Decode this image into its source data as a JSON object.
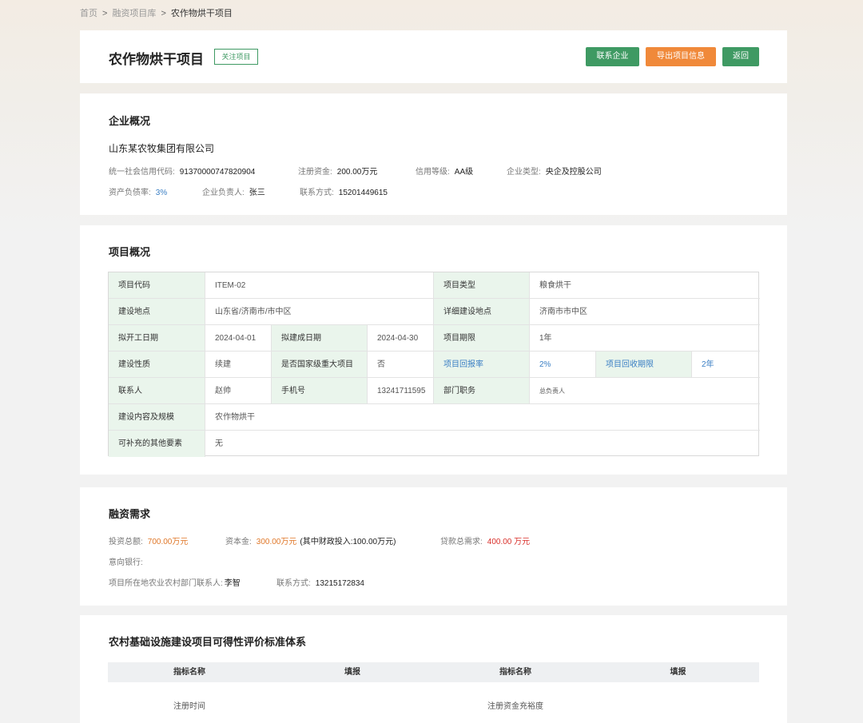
{
  "breadcrumb": [
    "首页",
    "融资项目库",
    "农作物烘干项目"
  ],
  "breadcrumb_sep": ">",
  "project": {
    "title": "农作物烘干项目",
    "follow_label": "关注项目",
    "actions": {
      "contact": "联系企业",
      "export": "导出项目信息",
      "back": "返回"
    }
  },
  "company": {
    "section_title": "企业概况",
    "name": "山东某农牧集团有限公司",
    "fields": [
      {
        "label": "统一社会信用代码:",
        "value": "91370000747820904"
      },
      {
        "label": "注册资金:",
        "value": "200.00万元"
      },
      {
        "label": "信用等级:",
        "value": "AA级"
      },
      {
        "label": "企业类型:",
        "value": "央企及控股公司"
      },
      {
        "label": "资产负债率:",
        "value": "3%"
      },
      {
        "label": "企业负责人:",
        "value": "张三"
      },
      {
        "label": "联系方式:",
        "value": "15201449615"
      }
    ]
  },
  "overview": {
    "section_title": "项目概况",
    "rows": [
      [
        "项目代码",
        "ITEM-02",
        "项目类型",
        "粮食烘干"
      ],
      [
        "建设地点",
        "山东省/济南市/市中区",
        "详细建设地点",
        "济南市市中区"
      ],
      [
        "拟开工日期",
        "2024-04-01",
        "拟建成日期",
        "2024-04-30",
        "项目期限",
        "1年"
      ],
      [
        "建设性质",
        "续建",
        "是否国家级重大项目",
        "否",
        "项目回报率",
        "2%",
        "项目回收期限",
        "2年"
      ],
      [
        "联系人",
        "赵帅",
        "手机号",
        "13241711595",
        "部门职务",
        "总负责人"
      ],
      [
        "建设内容及规模",
        "农作物烘干"
      ],
      [
        "可补充的其他要素",
        "无"
      ]
    ]
  },
  "finance": {
    "section_title": "融资需求",
    "total_label": "投资总额:",
    "total_value": "700.00万元",
    "capital_label": "资本金:",
    "capital_value": "300.00万元",
    "capital_note": "(其中财政投入:100.00万元)",
    "loan_label": "贷款总需求:",
    "loan_value": "400.00 万元",
    "bank_label": "意向银行:",
    "local_contact_label": "项目所在地农业农村部门联系人:",
    "local_contact_value": "李智",
    "phone_label": "联系方式:",
    "phone_value": "13215172834"
  },
  "evaluation": {
    "section_title": "农村基础设施建设项目可得性评价标准体系",
    "headers": [
      "指标名称",
      "填报",
      "指标名称",
      "填报"
    ],
    "rows": [
      [
        "注册时间",
        "",
        "注册资金充裕度",
        ""
      ]
    ]
  },
  "colors": {
    "accent_green": "#3f9a63",
    "accent_orange": "#f0893a",
    "link_blue": "#3b7fc4",
    "label_bg": "#eaf5ec"
  }
}
